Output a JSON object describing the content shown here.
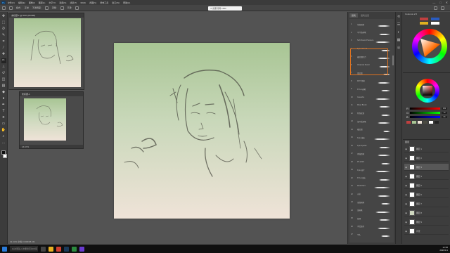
{
  "menubar": {
    "logo": "Ps",
    "items": [
      "文件(F)",
      "编辑(E)",
      "图像(I)",
      "图层(L)",
      "文字(Y)",
      "选择(S)",
      "滤镜(T)",
      "3D(D)",
      "视图(V)",
      "增效工具",
      "窗口(W)",
      "帮助(H)"
    ],
    "window_controls": [
      "—",
      "□",
      "✕"
    ]
  },
  "options_bar": {
    "search_text": "✕ 搜索代码 1002",
    "items": [
      "模式:",
      "正常",
      "不透明度:",
      "流量:",
      "平滑:"
    ]
  },
  "window_preview_1": {
    "title": "未标题-1 @ 50% (RGB/8)"
  },
  "window_preview_2": {
    "title": "未标题-1",
    "status": "16.67%"
  },
  "canvas": {
    "zoom_status": "33.33%   文档:3.00M/68.3M"
  },
  "brush_panel": {
    "tabs": [
      "画笔",
      "画笔设置"
    ],
    "items": [
      {
        "num": "1",
        "name": "常规画笔",
        "stroke": 0.7
      },
      {
        "num": "2",
        "name": "干介质画笔",
        "stroke": 0.6
      },
      {
        "num": "3",
        "name": "Soft Round Pressure",
        "stroke": 0.8
      },
      {
        "num": "4",
        "name": "Kyle's Pencil",
        "stroke": 0.5
      },
      {
        "num": "5",
        "name": "硬边圆压力",
        "stroke": 0.7
      },
      {
        "num": "6",
        "name": "Charcoal Pencil",
        "stroke": 0.6
      },
      {
        "num": "7",
        "name": "柔边圆",
        "stroke": 0.4
      },
      {
        "num": "8",
        "name": "DRY 铅笔",
        "stroke": 0.7
      },
      {
        "num": "9",
        "name": "KYLE 画笔",
        "stroke": 0.5
      },
      {
        "num": "10",
        "name": "Gouache",
        "stroke": 0.8
      },
      {
        "num": "11",
        "name": "Mixer Brush",
        "stroke": 0.6
      },
      {
        "num": "12",
        "name": "特殊效果",
        "stroke": 0.5
      },
      {
        "num": "13",
        "name": "湿介质画笔",
        "stroke": 0.7
      },
      {
        "num": "14",
        "name": "硬边圆",
        "stroke": 0.4
      },
      {
        "num": "15",
        "name": "Kyle 油画",
        "stroke": 0.9
      },
      {
        "num": "16",
        "name": "Kyle Spatter",
        "stroke": 0.6
      },
      {
        "num": "17",
        "name": "素描铅笔",
        "stroke": 0.7
      },
      {
        "num": "18",
        "name": "PS 2018",
        "stroke": 0.5
      },
      {
        "num": "19",
        "name": "Kyle 速写",
        "stroke": 0.8
      },
      {
        "num": "20",
        "name": "KYLE 墨水",
        "stroke": 0.6
      },
      {
        "num": "21",
        "name": "Real Paint",
        "stroke": 0.9
      },
      {
        "num": "22",
        "name": "水彩",
        "stroke": 0.7
      },
      {
        "num": "23",
        "name": "海绵画笔",
        "stroke": 0.5
      },
      {
        "num": "24",
        "name": "油画笔",
        "stroke": 0.8
      },
      {
        "num": "25",
        "name": "纹理",
        "stroke": 0.6
      },
      {
        "num": "26",
        "name": "手绘线条",
        "stroke": 0.7
      },
      {
        "num": "27",
        "name": "平头",
        "stroke": 0.5
      }
    ]
  },
  "color_panel": {
    "header": "Coolorus 2.5"
  },
  "picker_panel": {
    "sliders": [
      {
        "label": "R",
        "value": "181"
      },
      {
        "label": "G",
        "value": "72"
      },
      {
        "label": "B",
        "value": "63"
      }
    ]
  },
  "layers_panel": {
    "header": "图层",
    "layers": [
      "图层 1",
      "图层 2",
      "图层 3",
      "图层 4",
      "图层 5",
      "图层 6",
      "图层 7",
      "图层 8",
      "图层 9",
      "背景"
    ]
  },
  "taskbar": {
    "search": "在这里输入你要搜索的内容",
    "time": "12:58",
    "date": "2020/1/1"
  }
}
